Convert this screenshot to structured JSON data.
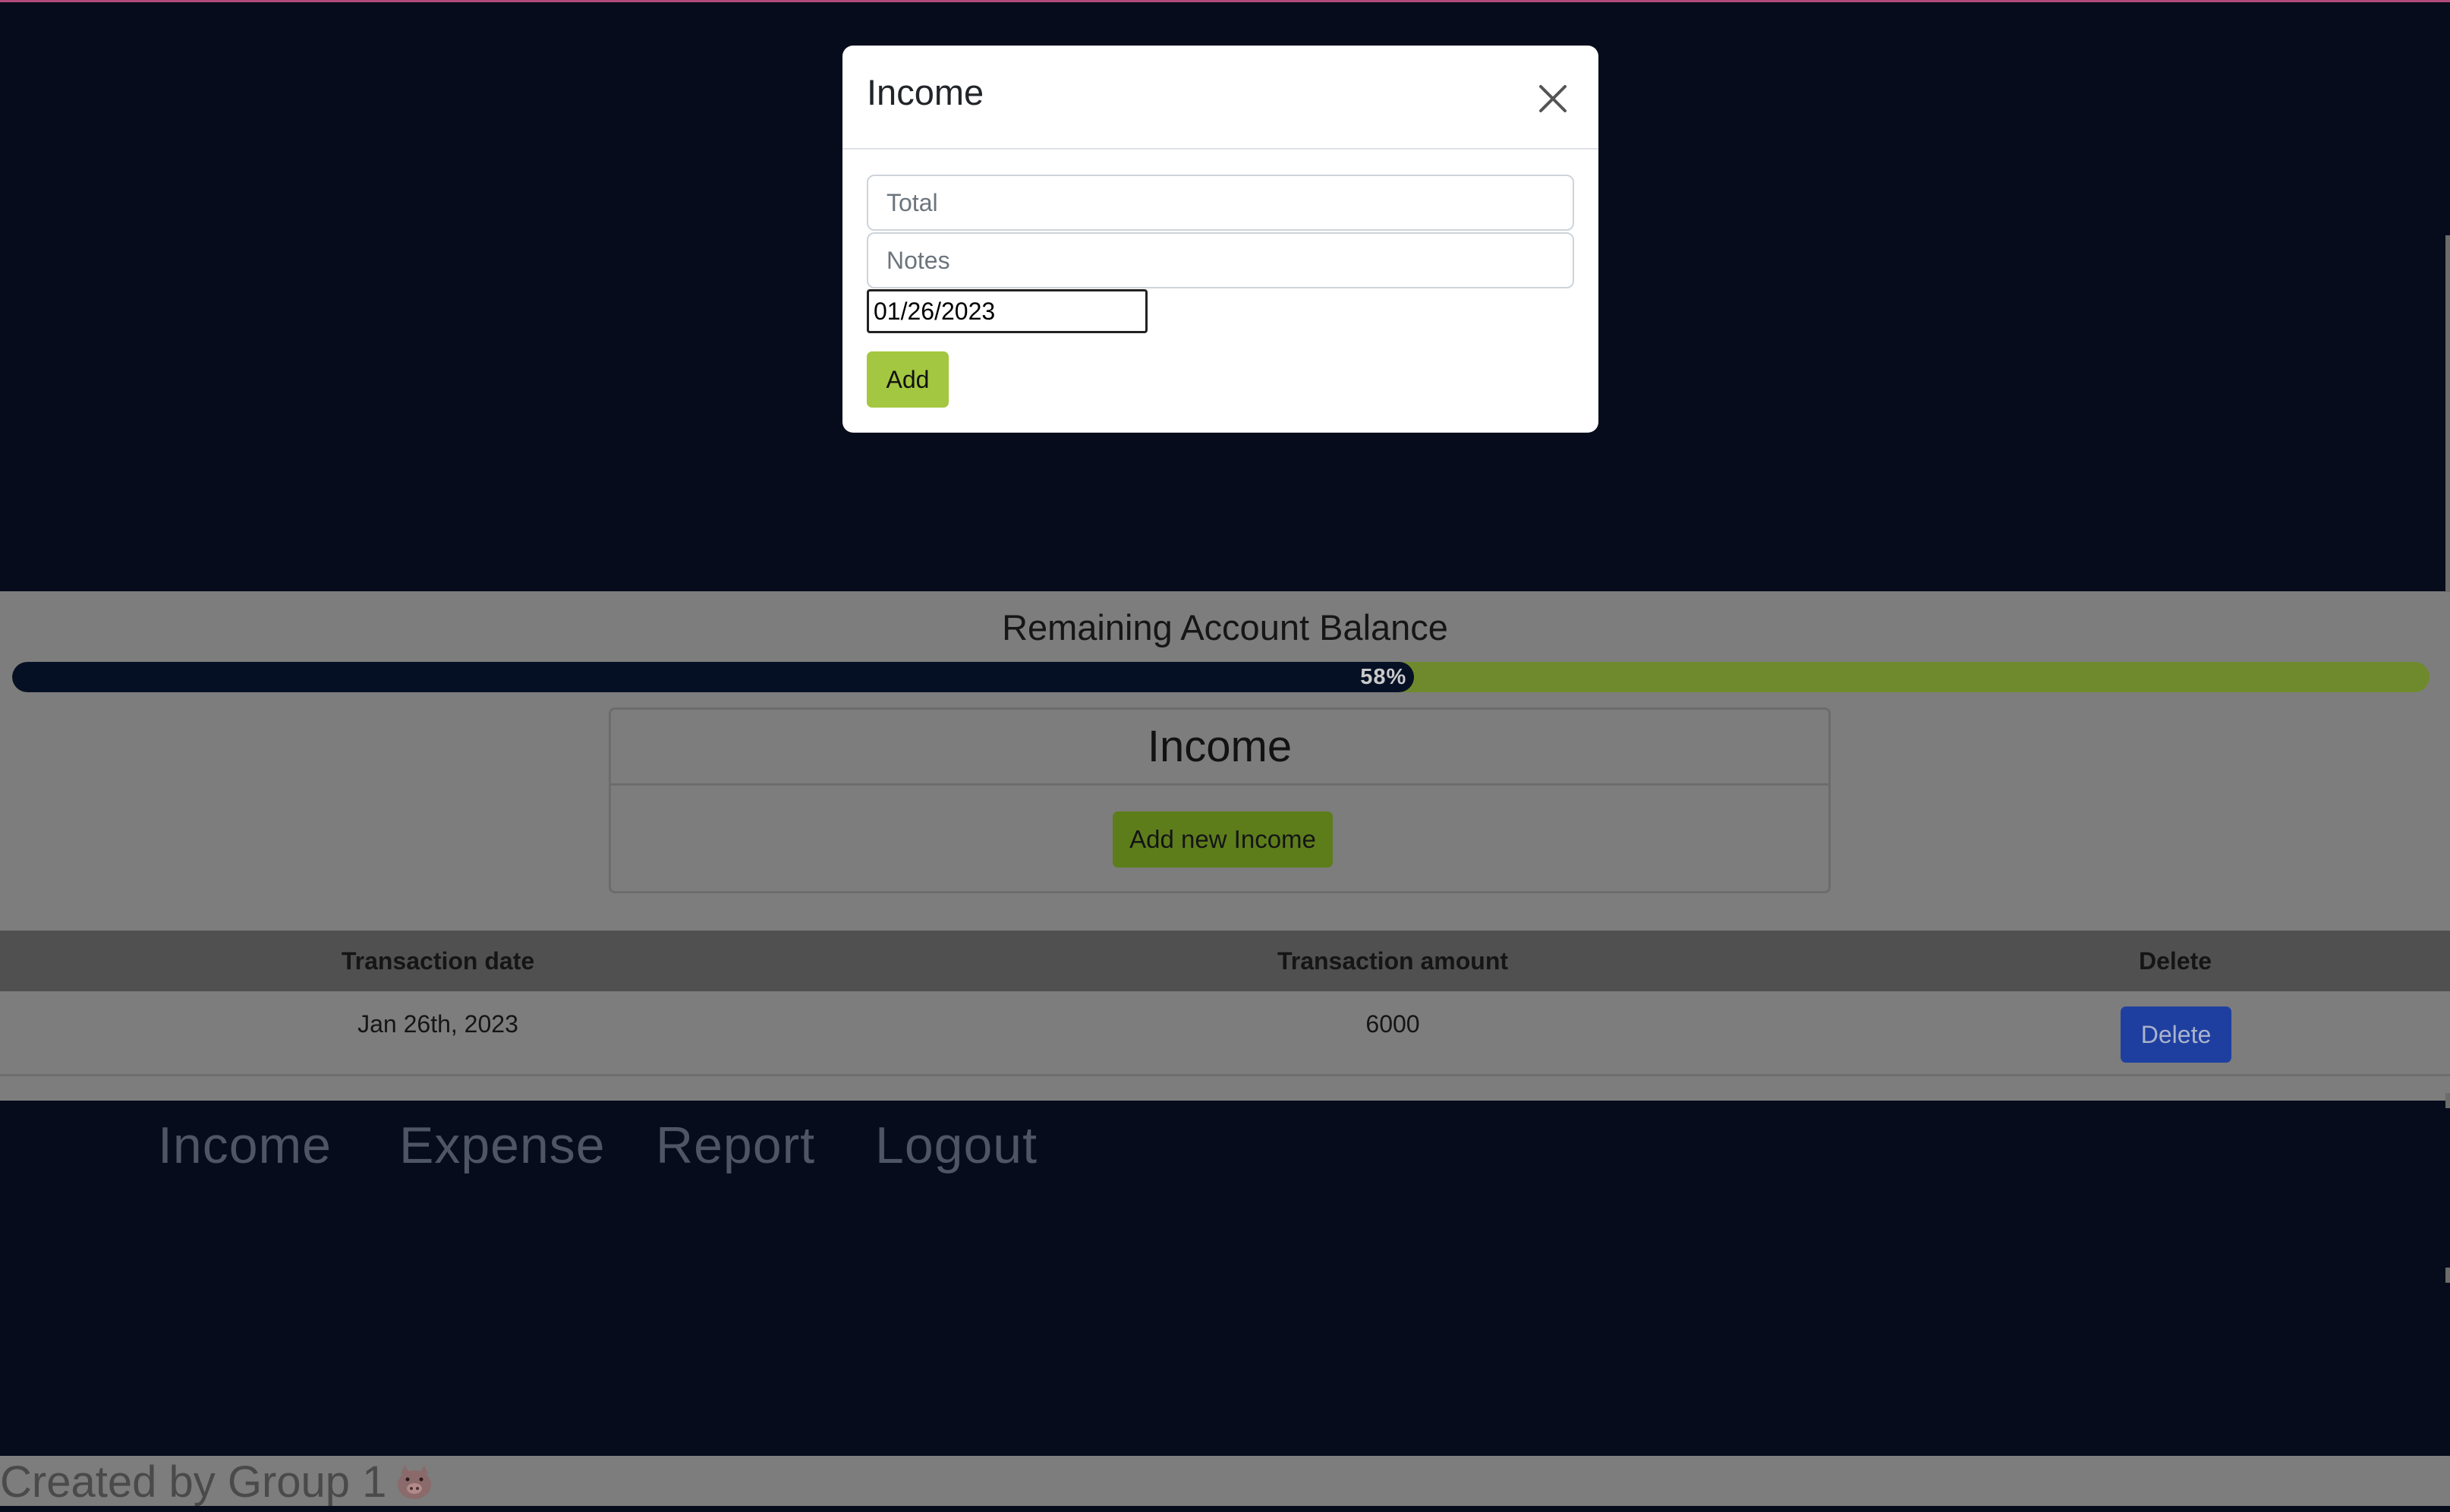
{
  "modal": {
    "title": "Income",
    "total_placeholder": "Total",
    "notes_placeholder": "Notes",
    "date_value": "01/26/2023",
    "add_label": "Add"
  },
  "balance": {
    "title": "Remaining Account Balance",
    "percent": 58,
    "percent_label": "58%"
  },
  "income_card": {
    "title": "Income",
    "add_new_label": "Add new Income"
  },
  "table": {
    "headers": [
      "Transaction date",
      "Transaction amount",
      "Delete"
    ],
    "rows": [
      {
        "date": "Jan 26th, 2023",
        "amount": "6000",
        "delete_label": "Delete"
      }
    ]
  },
  "nav": {
    "items": [
      "Income",
      "Expense",
      "Report",
      "Logout"
    ]
  },
  "footer": {
    "text": "Created by Group 1",
    "icon": "pig-icon"
  },
  "colors": {
    "page_background": "#060c1c",
    "progress_fill": "#061025",
    "progress_track": "#6f8a2c",
    "add_button": "#a3c740",
    "add_new_income_button": "#5d7d1b",
    "delete_button": "#1f3fa0"
  }
}
